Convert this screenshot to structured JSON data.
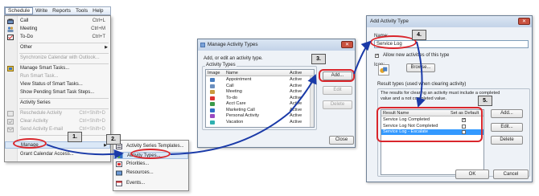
{
  "schedule_menu": {
    "menubar": [
      "Schedule",
      "Write",
      "Reports",
      "Tools",
      "Help"
    ],
    "items": [
      {
        "label": "Call",
        "shortcut": "Ctrl+L",
        "icon": "phone-icon",
        "enabled": true
      },
      {
        "label": "Meeting",
        "shortcut": "Ctrl+M",
        "icon": "meeting-icon",
        "enabled": true
      },
      {
        "label": "To-Do",
        "shortcut": "Ctrl+T",
        "icon": "todo-icon",
        "enabled": true
      },
      {
        "label": "Other",
        "shortcut": "",
        "icon": "",
        "enabled": true
      },
      {
        "label": "Synchronize Calendar with Outlook...",
        "shortcut": "",
        "icon": "",
        "enabled": false
      },
      {
        "label": "Manage Smart Tasks...",
        "shortcut": "",
        "icon": "smart-task-icon",
        "enabled": true
      },
      {
        "label": "Run Smart Task...",
        "shortcut": "",
        "icon": "",
        "enabled": false
      },
      {
        "label": "View Status of Smart Tasks...",
        "shortcut": "",
        "icon": "",
        "enabled": true
      },
      {
        "label": "Show Pending Smart Task Steps...",
        "shortcut": "",
        "icon": "",
        "enabled": true
      },
      {
        "label": "Activity Series",
        "shortcut": "",
        "icon": "",
        "enabled": true
      },
      {
        "label": "Reschedule Activity",
        "shortcut": "Ctrl+Shift+D",
        "icon": "reschedule-icon",
        "enabled": false
      },
      {
        "label": "Clear Activity",
        "shortcut": "Ctrl+Shift+D",
        "icon": "clear-icon",
        "enabled": false
      },
      {
        "label": "Send Activity E-mail",
        "shortcut": "Ctrl+Shift+D",
        "icon": "email-icon",
        "enabled": false
      },
      {
        "label": "Manage",
        "shortcut": "",
        "icon": "",
        "enabled": true
      },
      {
        "label": "Grant Calendar Access...",
        "shortcut": "",
        "icon": "",
        "enabled": true
      }
    ]
  },
  "submenu": {
    "items": [
      {
        "label": "Activity Series Templates...",
        "icon": "template-icon"
      },
      {
        "label": "Activity Types...",
        "icon": "activity-types-icon"
      },
      {
        "label": "Priorities...",
        "icon": "priorities-icon"
      },
      {
        "label": "Resources...",
        "icon": "resources-icon"
      },
      {
        "label": "Events...",
        "icon": "events-icon"
      }
    ]
  },
  "manage_dialog": {
    "title": "Manage Activity Types",
    "instruction": "Add, or edit an activity type.",
    "group_label": "Activity Types",
    "columns": [
      "Image",
      "Name",
      "Active"
    ],
    "rows": [
      {
        "name": "Appointment",
        "active": "Active",
        "icon": "appointment-icon"
      },
      {
        "name": "Call",
        "active": "Active",
        "icon": "phone-icon"
      },
      {
        "name": "Meeting",
        "active": "Active",
        "icon": "meeting-icon"
      },
      {
        "name": "To-do",
        "active": "Active",
        "icon": "todo-icon"
      },
      {
        "name": "Acct Care",
        "active": "Active",
        "icon": "acct-care-icon"
      },
      {
        "name": "Marketing Call",
        "active": "Active",
        "icon": "marketing-call-icon"
      },
      {
        "name": "Personal Activity",
        "active": "Active",
        "icon": "personal-activity-icon"
      },
      {
        "name": "Vacation",
        "active": "Active",
        "icon": "vacation-icon"
      }
    ],
    "buttons": {
      "add": "Add...",
      "edit": "Edit",
      "delete": "Delete",
      "close": "Close"
    }
  },
  "add_dialog": {
    "title": "Add Activity Type",
    "name_label": "Name:",
    "name_value": "Service Log",
    "checkbox_label": "Allow new activities of this type",
    "icon_label": "Icon:",
    "browse_button": "Browse...",
    "result_types_label": "Result types (used when clearing activity)",
    "result_info": "The results for clearing an activity must include a completed value and a not completed value.",
    "columns": [
      "Result Name",
      "Set as Default"
    ],
    "rows": [
      {
        "name": "Service Log Completed",
        "default": true,
        "selected": false
      },
      {
        "name": "Service Log Not Completed",
        "default": false,
        "selected": false
      },
      {
        "name": "Service Log - Escalate",
        "default": false,
        "selected": true
      }
    ],
    "buttons": {
      "add": "Add...",
      "edit": "Edit...",
      "delete": "Delete",
      "ok": "OK",
      "cancel": "Cancel"
    }
  },
  "callouts": [
    "1.",
    "2.",
    "3.",
    "4.",
    "5."
  ],
  "colors": {
    "annotation_red": "#d9262c",
    "arrow_blue": "#1a3aa8",
    "selection_blue": "#3399ff"
  }
}
